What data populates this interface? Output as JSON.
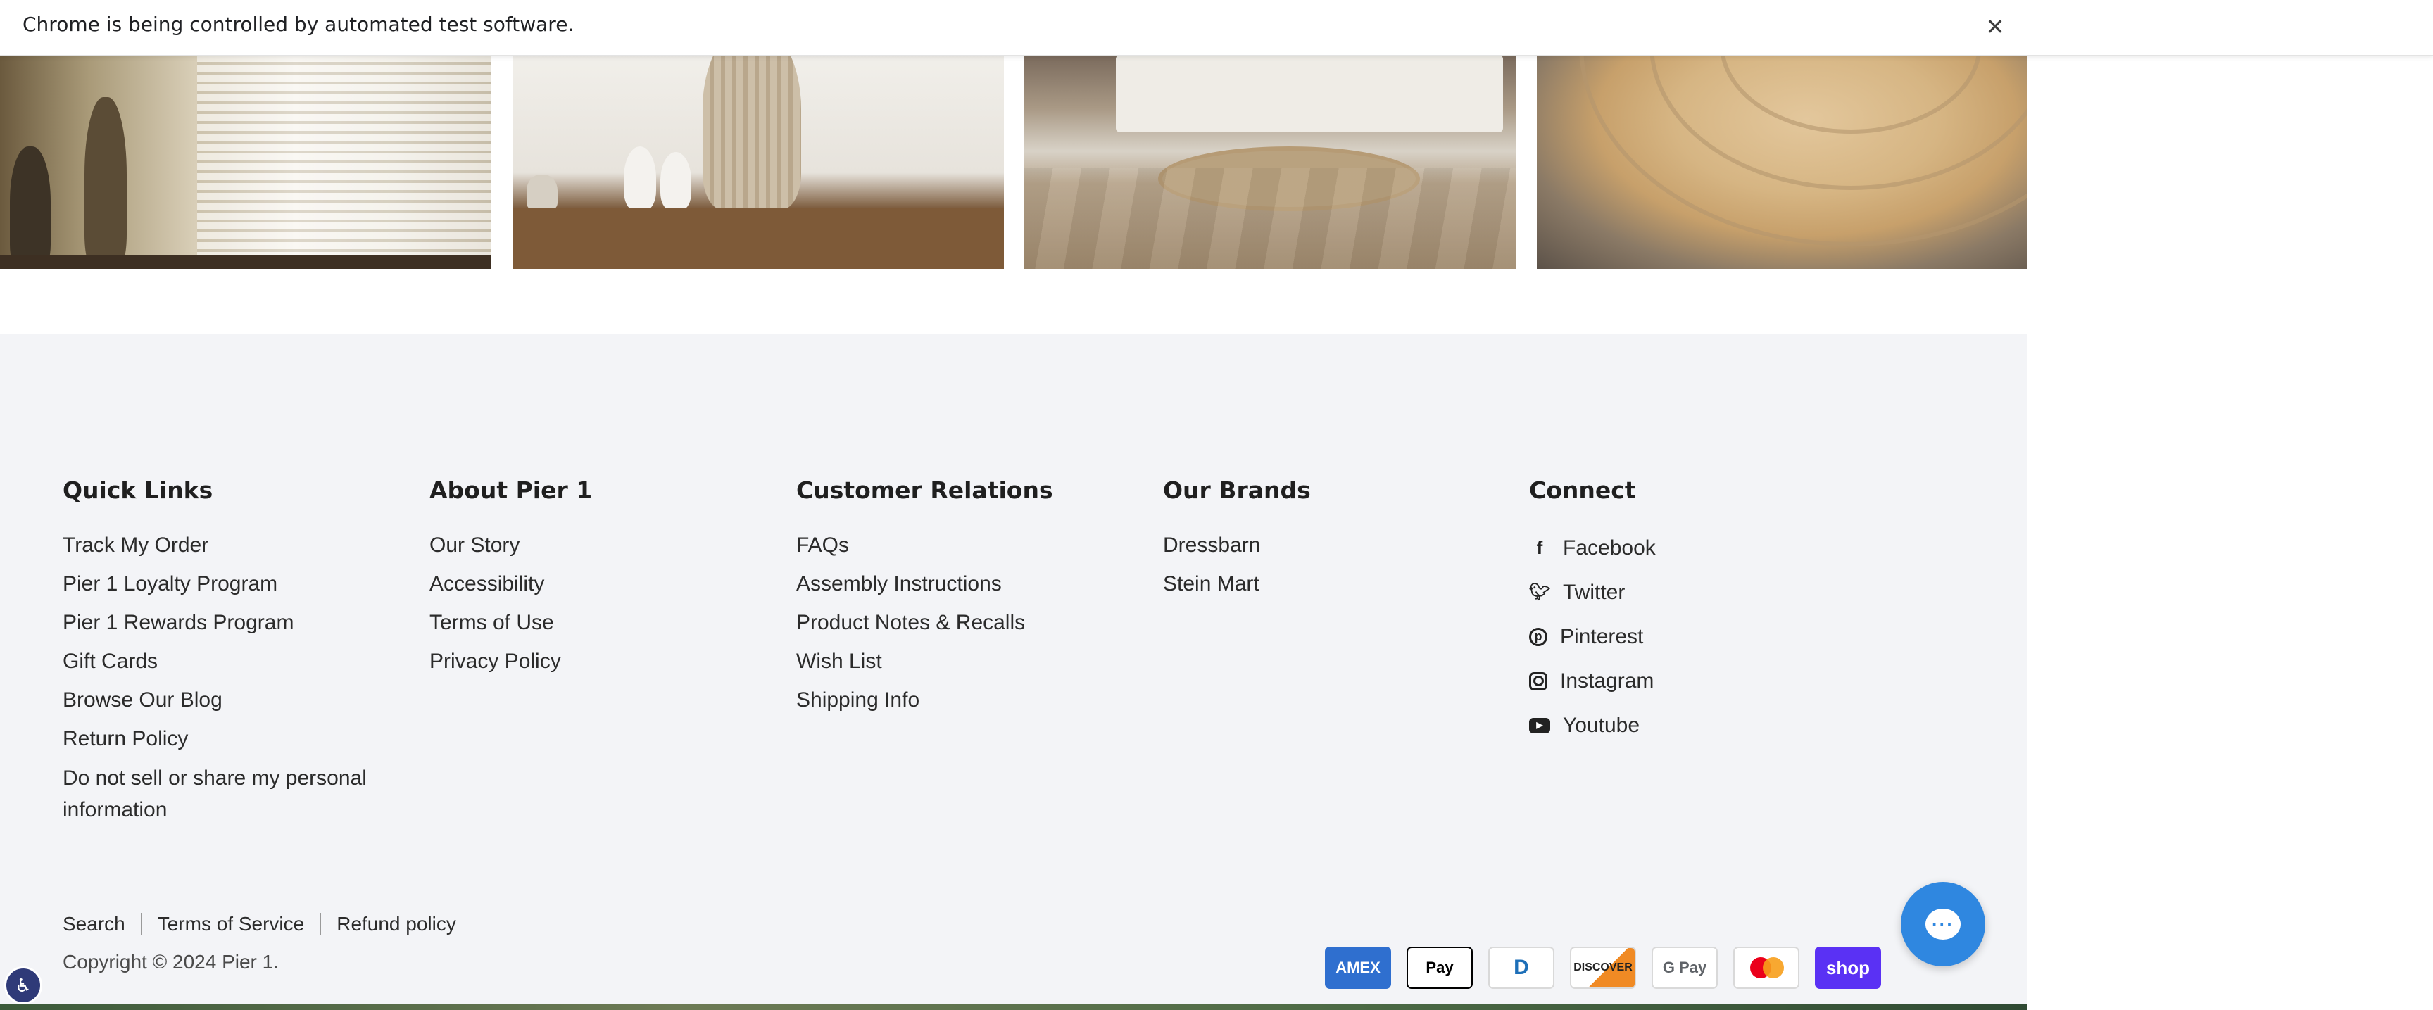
{
  "infobar": {
    "message": "Chrome is being controlled by automated test software.",
    "close_glyph": "✕"
  },
  "images": [
    {
      "name": "shutters-vase-image"
    },
    {
      "name": "bunny-sideboard-image"
    },
    {
      "name": "bedroom-round-rug-image"
    },
    {
      "name": "jute-rug-image"
    }
  ],
  "footer": {
    "columns": [
      {
        "title": "Quick Links",
        "items": [
          "Track My Order",
          "Pier 1 Loyalty Program",
          "Pier 1 Rewards Program",
          "Gift Cards",
          "Browse Our Blog",
          "Return Policy",
          "Do not sell or share my personal information"
        ]
      },
      {
        "title": "About Pier 1",
        "items": [
          "Our Story",
          "Accessibility",
          "Terms of Use",
          "Privacy Policy"
        ]
      },
      {
        "title": "Customer Relations",
        "items": [
          "FAQs",
          "Assembly Instructions",
          "Product Notes & Recalls",
          "Wish List",
          "Shipping Info"
        ]
      },
      {
        "title": "Our Brands",
        "items": [
          "Dressbarn",
          "Stein Mart"
        ]
      },
      {
        "title": "Connect",
        "items": [
          {
            "label": "Facebook",
            "icon": "facebook-icon"
          },
          {
            "label": "Twitter",
            "icon": "twitter-icon"
          },
          {
            "label": "Pinterest",
            "icon": "pinterest-icon"
          },
          {
            "label": "Instagram",
            "icon": "instagram-icon"
          },
          {
            "label": "Youtube",
            "icon": "youtube-icon"
          }
        ]
      }
    ],
    "bottom_links": [
      "Search",
      "Terms of Service",
      "Refund policy"
    ],
    "copyright": "Copyright © 2024 Pier 1.",
    "payment_methods": [
      {
        "name": "American Express",
        "label": "AMEX"
      },
      {
        "name": "Apple Pay",
        "label": " Pay"
      },
      {
        "name": "Diners Club",
        "label": "D"
      },
      {
        "name": "Discover",
        "label": "DISCOVER"
      },
      {
        "name": "Google Pay",
        "label": "G Pay"
      },
      {
        "name": "Mastercard",
        "label": ""
      },
      {
        "name": "Shop Pay",
        "label": "shop"
      }
    ]
  },
  "colors": {
    "footer_bg": "#f3f4f7",
    "chat_button": "#2f87e0",
    "accessibility_button": "#2f3a78",
    "shop_pay": "#5a31f4",
    "amex": "#2f6fcf"
  }
}
